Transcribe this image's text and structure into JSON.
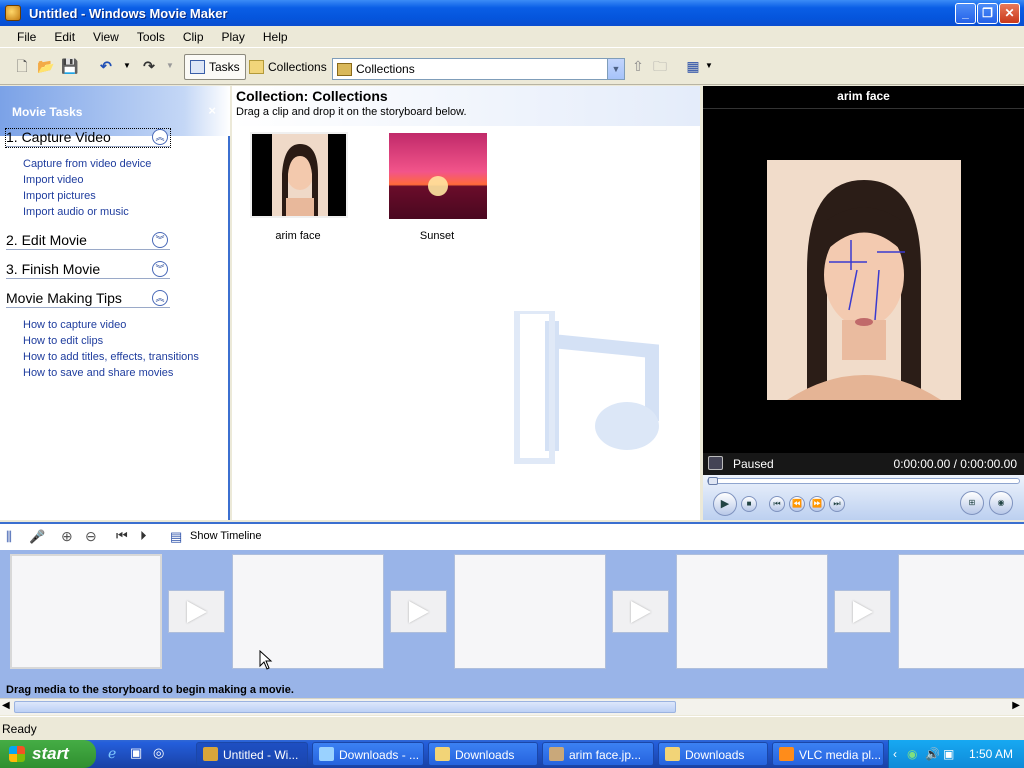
{
  "window": {
    "title": "Untitled - Windows Movie Maker"
  },
  "menu": [
    "File",
    "Edit",
    "View",
    "Tools",
    "Clip",
    "Play",
    "Help"
  ],
  "toolbar": {
    "tasks": "Tasks",
    "collections": "Collections",
    "combo_value": "Collections"
  },
  "tasks_pane": {
    "header": "Movie Tasks",
    "close": "×",
    "sections": [
      {
        "title": "1. Capture Video",
        "links": [
          "Capture from video device",
          "Import video",
          "Import pictures",
          "Import audio or music"
        ]
      },
      {
        "title": "2. Edit Movie",
        "links": []
      },
      {
        "title": "3. Finish Movie",
        "links": []
      },
      {
        "title": "Movie Making Tips",
        "links": [
          "How to capture video",
          "How to edit clips",
          "How to add titles, effects, transitions",
          "How to save and share movies"
        ]
      }
    ]
  },
  "collection": {
    "heading": "Collection: Collections",
    "subtitle": "Drag a clip and drop it on the storyboard below.",
    "items": [
      {
        "caption": "arim face"
      },
      {
        "caption": "Sunset"
      }
    ]
  },
  "preview": {
    "title": "arim face",
    "status": "Paused",
    "time": "0:00:00.00 / 0:00:00.00"
  },
  "storyboard": {
    "show_timeline": "Show Timeline",
    "message": "Drag media to the storyboard to begin making a movie."
  },
  "statusbar": {
    "text": "Ready"
  },
  "taskbar": {
    "start": "start",
    "tasks": [
      "Untitled - Wi...",
      "Downloads - ...",
      "Downloads",
      "arim face.jp...",
      "Downloads",
      "VLC media pl..."
    ],
    "clock": "1:50 AM"
  },
  "colors": {
    "titlebar": "#0555dc",
    "link": "#1f3d9e",
    "storyboard": "#99b4e8",
    "taskbar": "#245edb"
  }
}
